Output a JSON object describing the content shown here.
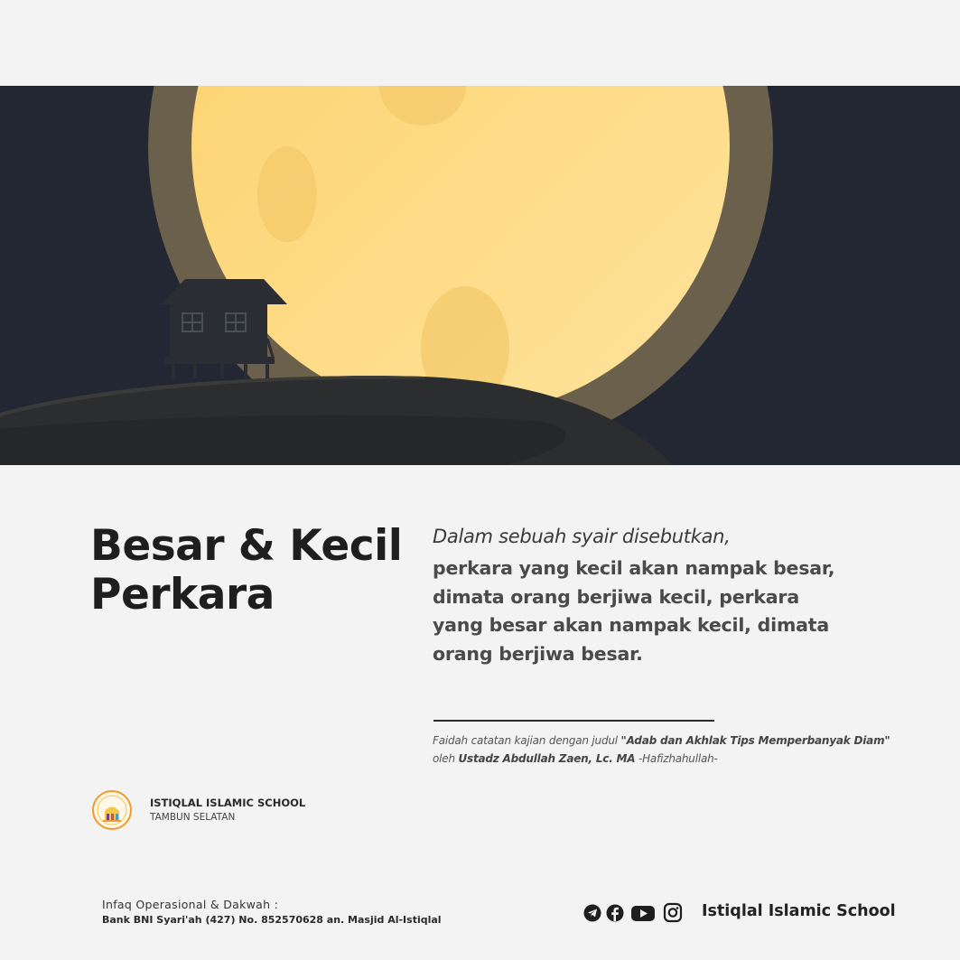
{
  "title": {
    "line1": "Besar & Kecil",
    "line2": "Perkara"
  },
  "quote": {
    "intro": "Dalam sebuah syair disebutkan,",
    "body": "perkara yang kecil akan nampak besar, dimata orang berjiwa kecil, perkara yang besar akan nampak kecil, dimata orang berjiwa besar."
  },
  "source": {
    "prefix": "Faidah catatan kajian dengan judul ",
    "topic": "\"Adab dan Akhlak Tips Memperbanyak Diam\"",
    "by": "oleh ",
    "speaker": "Ustadz Abdullah Zaen, Lc. MA",
    "suffix": " -Hafizhahullah-"
  },
  "school": {
    "name": "ISTIQLAL ISLAMIC SCHOOL",
    "location": "TAMBUN SELATAN"
  },
  "footer": {
    "infaq_label": "Infaq Operasional & Dakwah :",
    "bank": "Bank BNI Syari'ah (427) No. 852570628 an. Masjid Al-Istiqlal",
    "brand": "Istiqlal Islamic School",
    "social_icons": [
      "telegram-icon",
      "facebook-icon",
      "youtube-icon",
      "instagram-icon"
    ]
  },
  "colors": {
    "night_sky": "#222733",
    "moon": "#fdd77a",
    "moon_halo": "#6b604c",
    "hill": "#2b2d2e",
    "page_bg": "#f3f3f3",
    "text_dark": "#1e1e1e"
  }
}
